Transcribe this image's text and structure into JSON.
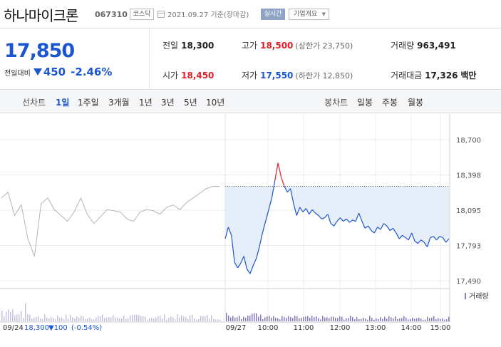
{
  "header": {
    "stock_name": "하나마이크론",
    "stock_code": "067310",
    "market": "코스닥",
    "date_text": "2021.09.27 기준(장마감)",
    "realtime_label": "실시간",
    "company_label": "기업개요"
  },
  "summary": {
    "current_price": "17,850",
    "change_label": "전일대비",
    "change_value": "450",
    "change_pct": "-2.46%",
    "prev_close": {
      "label": "전일",
      "value": "18,300"
    },
    "high": {
      "label": "고가",
      "value": "18,500",
      "sub": "(상한가 23,750)"
    },
    "volume": {
      "label": "거래량",
      "value": "963,491"
    },
    "open": {
      "label": "시가",
      "value": "18,450"
    },
    "low": {
      "label": "저가",
      "value": "17,550",
      "sub": "(하한가 12,850)"
    },
    "amount": {
      "label": "거래대금",
      "value": "17,326",
      "unit": "백만"
    }
  },
  "tabs": {
    "line_label": "선차트",
    "line_items": [
      "1일",
      "1주일",
      "3개월",
      "1년",
      "3년",
      "5년",
      "10년"
    ],
    "active_line": "1일",
    "candle_label": "봉차트",
    "candle_items": [
      "일봉",
      "주봉",
      "월봉"
    ]
  },
  "colors": {
    "blue": "#1a56cf",
    "red": "#e0202a",
    "fill": "#e6eef9",
    "prev": "#b5b5b5"
  },
  "chart_data": {
    "type": "line",
    "y_ticks": [
      "18,700",
      "18,398",
      "18,095",
      "17,793",
      "17,490"
    ],
    "ylim": [
      17490,
      18700
    ],
    "prev_close_value": 18300,
    "x_ticks": [
      "09/27",
      "10:00",
      "11:00",
      "12:00",
      "13:00",
      "14:00",
      "15:00"
    ],
    "volume_label": "거래량",
    "prev_day_caption": {
      "date": "09/24",
      "price": "18,300",
      "change": "▼100",
      "pct": "(-0.54%)"
    },
    "series": [
      {
        "values": [
          17850,
          17950,
          17880,
          17650,
          17600,
          17640,
          17700,
          17590,
          17550,
          17620,
          17680,
          17780,
          17900,
          18000,
          18100,
          18200,
          18350,
          18500,
          18380,
          18300,
          18250,
          18280,
          18150,
          18050,
          18120,
          18080,
          18110,
          18060,
          18100,
          18070,
          18050,
          18020,
          18030,
          18060,
          17980,
          17960,
          18000,
          18030,
          18000,
          18020,
          17990,
          18010,
          18000,
          18070,
          18000,
          17940,
          17960,
          17920,
          17900,
          17950,
          17930,
          17980,
          17960,
          17920,
          17940,
          17900,
          17850,
          17880,
          17860,
          17840,
          17900,
          17830,
          17810,
          17840,
          17820,
          17780,
          17860,
          17870,
          17840,
          17870,
          17860,
          17820,
          17850
        ]
      },
      {
        "values": [
          18200,
          18250,
          18050,
          18140,
          17850,
          17700,
          18150,
          18200,
          18100,
          18050,
          18000,
          18080,
          18200,
          18060,
          17980,
          18040,
          18100,
          18090,
          18080,
          18020,
          18000,
          18080,
          18100,
          18090,
          18060,
          18120,
          18140,
          18100,
          18160,
          18200,
          18240,
          18280,
          18300,
          18300
        ]
      }
    ]
  }
}
